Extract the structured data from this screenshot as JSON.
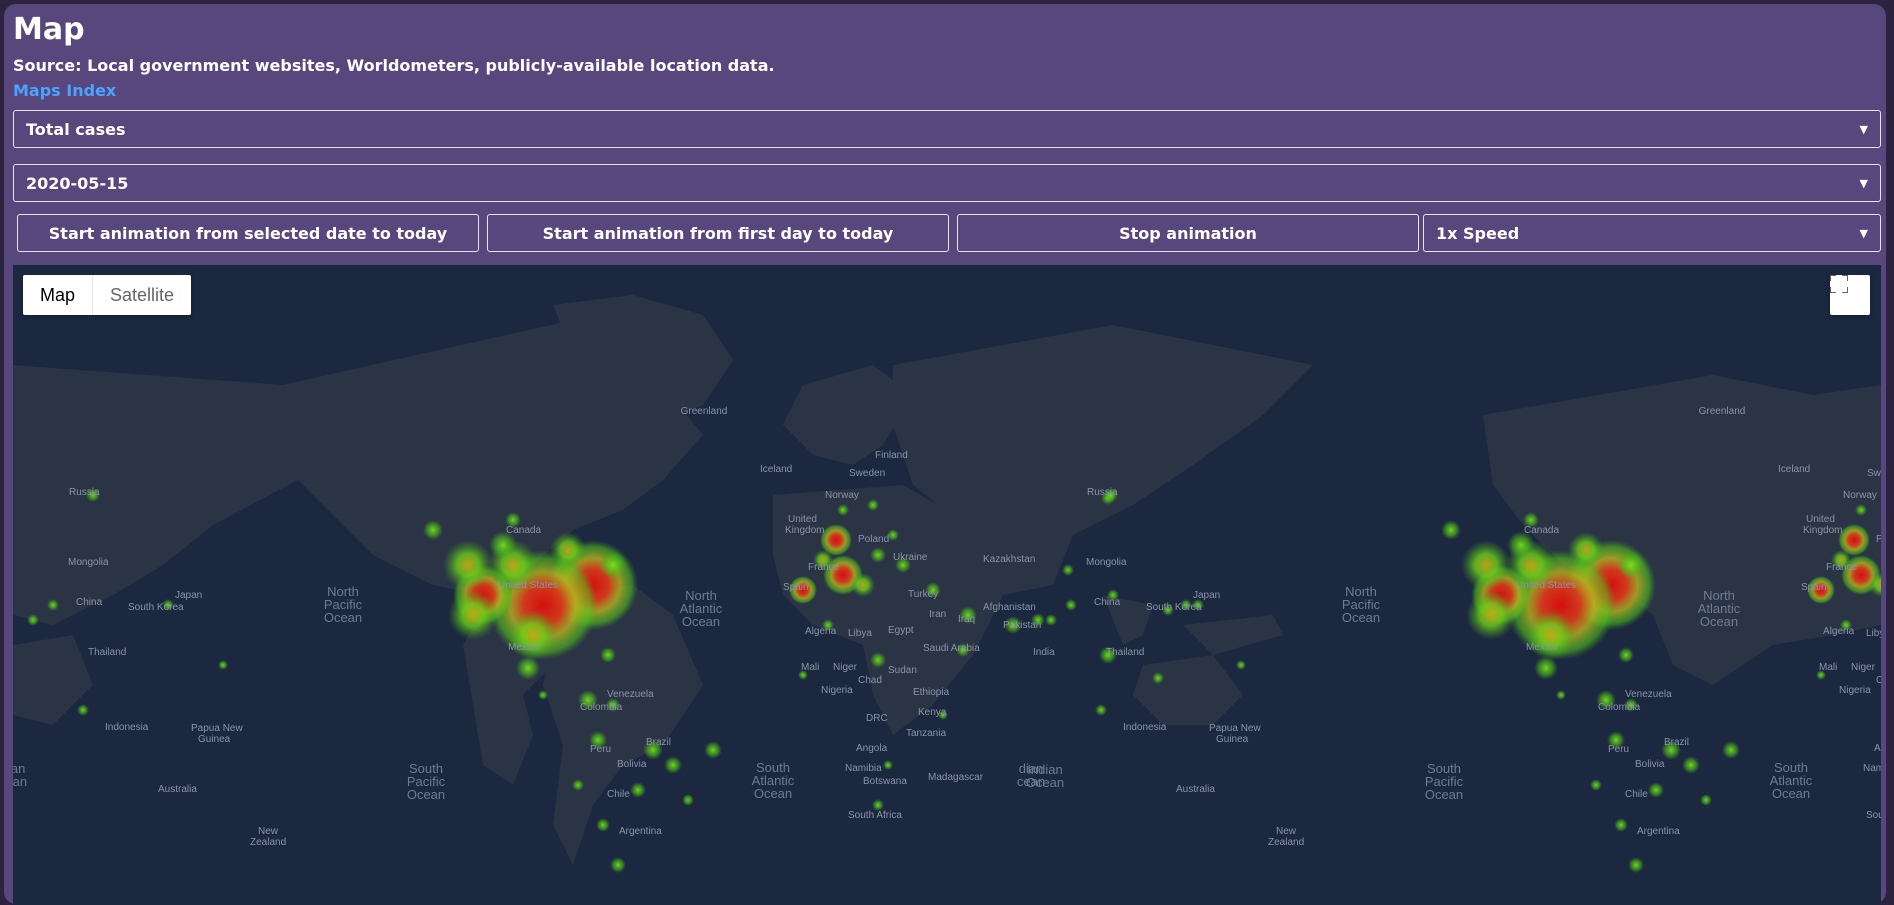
{
  "header": {
    "title": "Map",
    "source": "Source: Local government websites, Worldometers, publicly-available location data.",
    "maps_index_link": "Maps Index"
  },
  "controls": {
    "metric_select": "Total cases",
    "date_select": "2020-05-15",
    "start_from_selected_button": "Start animation from selected date to today",
    "start_from_first_button": "Start animation from first day to today",
    "stop_button": "Stop animation",
    "speed_select": "1x Speed"
  },
  "map": {
    "type_map_label": "Map",
    "type_satellite_label": "Satellite",
    "colors": {
      "background": "#1c2740",
      "land": "#2b3445",
      "heat_low": "#5fd31a",
      "heat_mid": "#e0c21b",
      "heat_high": "#c81414"
    },
    "place_labels": {
      "greenland": "Greenland",
      "iceland": "Iceland",
      "finland": "Finland",
      "sweden": "Sweden",
      "norway": "Norway",
      "united_kingdom": "United Kingdom",
      "poland": "Poland",
      "ukraine": "Ukraine",
      "france": "France",
      "spain": "Spain",
      "russia": "Russia",
      "kazakhstan": "Kazakhstan",
      "mongolia": "Mongolia",
      "china": "China",
      "south_korea": "South Korea",
      "japan": "Japan",
      "canada": "Canada",
      "united_states": "United States",
      "mexico": "Mexico",
      "turkey": "Turkey",
      "iran": "Iran",
      "iraq": "Iraq",
      "afghanistan": "Afghanistan",
      "pakistan": "Pakistan",
      "india": "India",
      "thailand": "Thailand",
      "algeria": "Algeria",
      "libya": "Libya",
      "egypt": "Egypt",
      "saudi_arabia": "Saudi Arabia",
      "mali": "Mali",
      "niger": "Niger",
      "chad": "Chad",
      "sudan": "Sudan",
      "nigeria": "Nigeria",
      "ethiopia": "Ethiopia",
      "drc": "DRC",
      "kenya": "Kenya",
      "tanzania": "Tanzania",
      "angola": "Angola",
      "namibia": "Namibia",
      "botswana": "Botswana",
      "madagascar": "Madagascar",
      "south_africa": "South Africa",
      "venezuela": "Venezuela",
      "colombia": "Colombia",
      "peru": "Peru",
      "brazil": "Brazil",
      "bolivia": "Bolivia",
      "chile": "Chile",
      "argentina": "Argentina",
      "indonesia": "Indonesia",
      "papua_new_guinea": "Papua New Guinea",
      "australia": "Australia",
      "new_zealand": "New Zealand",
      "india_fragment": "India",
      "indian_ocean_fragment": "dian cean",
      "sou_fragment": "So"
    },
    "ocean_labels": {
      "north_pacific": "North Pacific Ocean",
      "north_atlantic": "North Atlantic Ocean",
      "south_pacific": "South Pacific Ocean",
      "south_atlantic": "South Atlantic Ocean",
      "indian": "Indian Ocean"
    }
  }
}
